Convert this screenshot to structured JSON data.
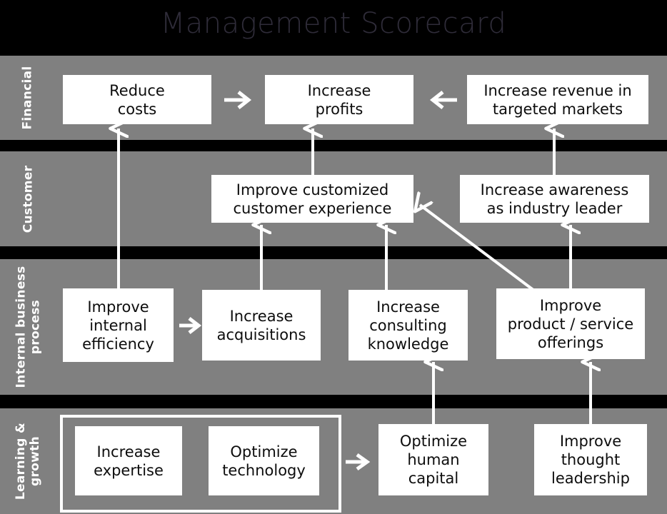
{
  "title": "Management Scorecard",
  "colors": {
    "page_background": "#000000",
    "band_background": "#808080",
    "box_background": "#ffffff",
    "box_text": "#0d0d0d",
    "band_label_text": "#ffffff",
    "title_text": "#2f2c39",
    "connector": "#ffffff"
  },
  "perspectives": [
    {
      "id": "financial",
      "label": "Financial"
    },
    {
      "id": "customer",
      "label": "Customer"
    },
    {
      "id": "internal",
      "label": "Internal business\nprocess"
    },
    {
      "id": "learning",
      "label": "Learning &\ngrowth"
    }
  ],
  "objectives": {
    "financial": [
      {
        "id": "reduce-costs",
        "label": "Reduce\ncosts"
      },
      {
        "id": "increase-profits",
        "label": "Increase\nprofits"
      },
      {
        "id": "increase-revenue",
        "label": "Increase revenue in\ntargeted markets"
      }
    ],
    "customer": [
      {
        "id": "improve-customer-experience",
        "label": "Improve customized\ncustomer experience"
      },
      {
        "id": "increase-awareness",
        "label": "Increase awareness\nas industry leader"
      }
    ],
    "internal": [
      {
        "id": "improve-internal-efficiency",
        "label": "Improve\ninternal\nefficiency"
      },
      {
        "id": "increase-acquisitions",
        "label": "Increase\nacquisitions"
      },
      {
        "id": "increase-consulting",
        "label": "Increase\nconsulting\nknowledge"
      },
      {
        "id": "improve-product-service",
        "label": "Improve\nproduct / service\nofferings"
      }
    ],
    "learning": [
      {
        "id": "increase-expertise",
        "label": "Increase\nexpertise"
      },
      {
        "id": "optimize-technology",
        "label": "Optimize\ntechnology"
      },
      {
        "id": "optimize-human-capital",
        "label": "Optimize\nhuman\ncapital"
      },
      {
        "id": "improve-thought-leadership",
        "label": "Improve\nthought\nleadership"
      }
    ]
  },
  "connectors": [
    {
      "id": "reduce-costs-to-increase-profits",
      "type": "horizontal-right"
    },
    {
      "id": "increase-revenue-to-increase-profits",
      "type": "horizontal-left"
    },
    {
      "id": "improve-internal-efficiency-to-reduce-costs",
      "type": "vertical-up"
    },
    {
      "id": "improve-customer-experience-to-increase-profits",
      "type": "vertical-up"
    },
    {
      "id": "increase-awareness-to-increase-revenue",
      "type": "vertical-up"
    },
    {
      "id": "increase-acquisitions-to-customer-experience",
      "type": "vertical-up"
    },
    {
      "id": "increase-consulting-to-customer-experience",
      "type": "vertical-up"
    },
    {
      "id": "improve-product-service-to-increase-awareness",
      "type": "vertical-up"
    },
    {
      "id": "improve-product-service-to-customer-experience",
      "type": "diagonal-up-left"
    },
    {
      "id": "improve-internal-efficiency-to-increase-acquisitions",
      "type": "horizontal-right"
    },
    {
      "id": "optimize-human-capital-to-increase-consulting",
      "type": "vertical-up"
    },
    {
      "id": "improve-thought-leadership-to-product-service",
      "type": "vertical-up"
    },
    {
      "id": "learning-cluster-to-optimize-human-capital",
      "type": "horizontal-right"
    }
  ]
}
